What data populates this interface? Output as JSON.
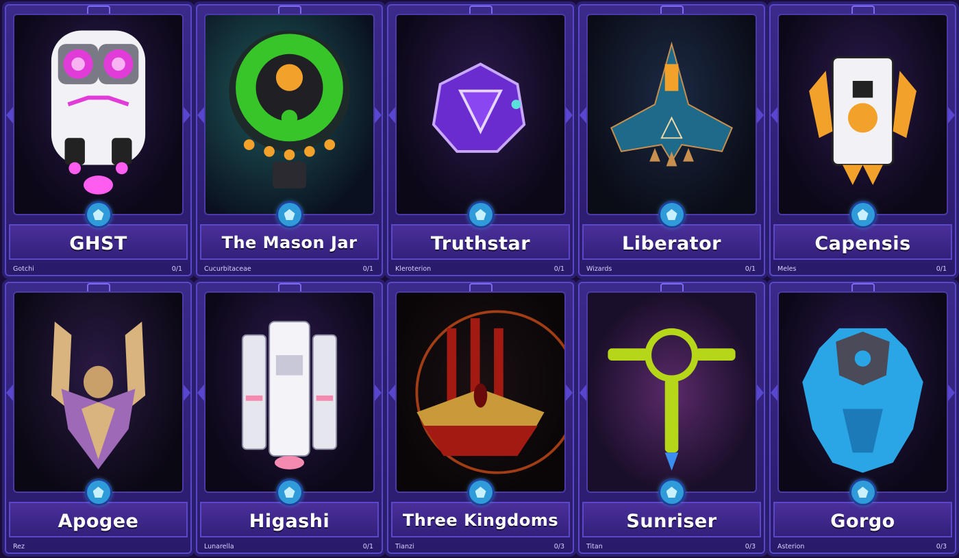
{
  "cards": [
    {
      "name": "GHST",
      "collection": "Gotchi",
      "count": "0/1",
      "art": "robot-ghost-ship-icon",
      "accent": "#e23cd8"
    },
    {
      "name": "The Mason Jar",
      "collection": "Cucurbitaceae",
      "count": "0/1",
      "art": "green-saucer-ship-icon",
      "accent": "#37c52a"
    },
    {
      "name": "Truthstar",
      "collection": "Kleroterion",
      "count": "0/1",
      "art": "d20-dice-ship-icon",
      "accent": "#7a37e8"
    },
    {
      "name": "Liberator",
      "collection": "Wizards",
      "count": "0/1",
      "art": "blue-wizard-ship-icon",
      "accent": "#1d6a8a"
    },
    {
      "name": "Capensis",
      "collection": "Meles",
      "count": "0/1",
      "art": "orange-badger-ship-icon",
      "accent": "#f2a12a"
    },
    {
      "name": "Apogee",
      "collection": "Rez",
      "count": "",
      "art": "tan-claw-ship-icon",
      "accent": "#d9b47f"
    },
    {
      "name": "Higashi",
      "collection": "Lunarella",
      "count": "0/1",
      "art": "white-mech-ship-icon",
      "accent": "#f3f3f8"
    },
    {
      "name": "Three Kingdoms",
      "collection": "Tianzi",
      "count": "0/3",
      "art": "crimson-crown-ship-icon",
      "accent": "#a21a12"
    },
    {
      "name": "Sunriser",
      "collection": "Titan",
      "count": "0/3",
      "art": "lime-ankh-ship-icon",
      "accent": "#b6d61a"
    },
    {
      "name": "Gorgo",
      "collection": "Asterion",
      "count": "0/3",
      "art": "blue-crystal-ship-icon",
      "accent": "#2aa6e6"
    }
  ]
}
